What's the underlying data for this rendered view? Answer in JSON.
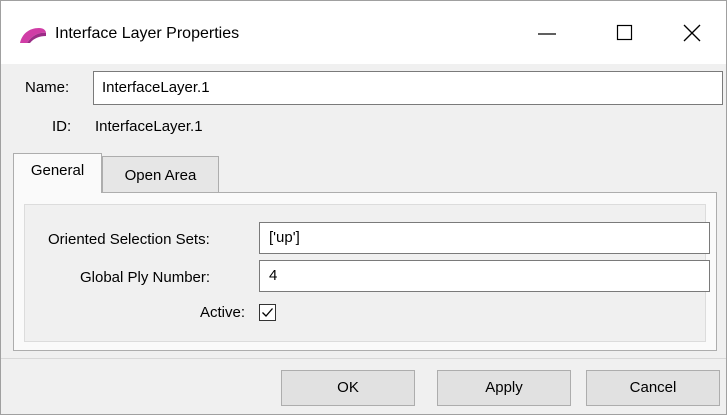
{
  "window": {
    "title": "Interface Layer Properties",
    "icon": "shell-icon",
    "accent_color": "#d03da6"
  },
  "form": {
    "name_label": "Name:",
    "name_value": "InterfaceLayer.1",
    "id_label": "ID:",
    "id_value": "InterfaceLayer.1"
  },
  "tabs": [
    {
      "label": "General",
      "selected": true
    },
    {
      "label": "Open Area",
      "selected": false
    }
  ],
  "general": {
    "oriented_selection_sets_label": "Oriented Selection Sets:",
    "oriented_selection_sets_value": "['up']",
    "global_ply_number_label": "Global Ply Number:",
    "global_ply_number_value": "4",
    "active_label": "Active:",
    "active_checked": true
  },
  "buttons": {
    "ok": "OK",
    "apply": "Apply",
    "cancel": "Cancel"
  }
}
